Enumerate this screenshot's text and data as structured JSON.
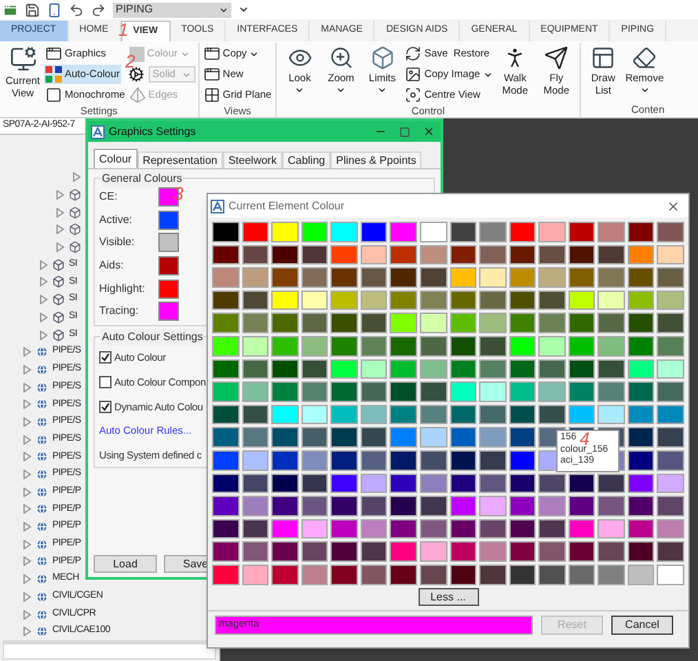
{
  "quick_access": {
    "workspace": "PIPING"
  },
  "ribbon_tabs": [
    {
      "label": "PROJECT",
      "kind": "application",
      "selected": false
    },
    {
      "label": "HOME",
      "kind": "tab",
      "selected": false
    },
    {
      "label": "VIEW",
      "kind": "tab",
      "selected": true
    },
    {
      "label": "TOOLS",
      "kind": "tab",
      "selected": false
    },
    {
      "label": "INTERFACES",
      "kind": "tab",
      "selected": false
    },
    {
      "label": "MANAGE",
      "kind": "tab",
      "selected": false
    },
    {
      "label": "DESIGN AIDS",
      "kind": "tab",
      "selected": false
    },
    {
      "label": "GENERAL",
      "kind": "tab",
      "selected": false
    },
    {
      "label": "EQUIPMENT",
      "kind": "tab",
      "selected": false
    },
    {
      "label": "PIPING",
      "kind": "tab",
      "selected": false
    }
  ],
  "ribbon_groups": [
    {
      "label": "Settings",
      "items": [
        {
          "kind": "large",
          "label": "Current View",
          "disabled": false,
          "highlighted": false,
          "dropdown": false
        },
        {
          "kind": "small",
          "label": "Graphics",
          "disabled": false,
          "highlighted": false,
          "dropdown": false
        },
        {
          "kind": "small",
          "label": "Auto-Colour",
          "disabled": false,
          "highlighted": true,
          "dropdown": false
        },
        {
          "kind": "small",
          "label": "Monochrome",
          "disabled": false,
          "highlighted": false,
          "dropdown": false
        },
        {
          "kind": "small",
          "label": "Colour",
          "disabled": true,
          "highlighted": false,
          "dropdown": true
        },
        {
          "kind": "combo",
          "label": "Solid",
          "disabled": true,
          "highlighted": false,
          "dropdown": true
        },
        {
          "kind": "small",
          "label": "Edges",
          "disabled": true,
          "highlighted": false,
          "dropdown": false
        }
      ]
    },
    {
      "label": "Views",
      "items": [
        {
          "kind": "small",
          "label": "Copy",
          "disabled": false,
          "highlighted": false,
          "dropdown": true
        },
        {
          "kind": "small",
          "label": "New",
          "disabled": false,
          "highlighted": false,
          "dropdown": false
        },
        {
          "kind": "small",
          "label": "Grid Plane",
          "disabled": false,
          "highlighted": false,
          "dropdown": false
        }
      ]
    },
    {
      "label": "Control",
      "items": [
        {
          "kind": "large",
          "label": "Look",
          "disabled": false,
          "highlighted": false,
          "dropdown": true
        },
        {
          "kind": "large",
          "label": "Zoom",
          "disabled": false,
          "highlighted": false,
          "dropdown": true
        },
        {
          "kind": "large",
          "label": "Limits",
          "disabled": false,
          "highlighted": false,
          "dropdown": true
        },
        {
          "kind": "small",
          "label": "Save",
          "label2": "Restore",
          "disabled": false,
          "highlighted": false,
          "dropdown": false
        },
        {
          "kind": "small",
          "label": "Copy Image",
          "disabled": false,
          "highlighted": false,
          "dropdown": true
        },
        {
          "kind": "small",
          "label": "Centre View",
          "disabled": false,
          "highlighted": false,
          "dropdown": false
        },
        {
          "kind": "large",
          "label": "Walk Mode",
          "disabled": false,
          "highlighted": false,
          "dropdown": false
        },
        {
          "kind": "large",
          "label": "Fly Mode",
          "disabled": false,
          "highlighted": false,
          "dropdown": false
        }
      ]
    },
    {
      "label": "Conten",
      "items": [
        {
          "kind": "large",
          "label": "Draw List",
          "disabled": false,
          "highlighted": false,
          "dropdown": false
        },
        {
          "kind": "large",
          "label": "Remove",
          "disabled": false,
          "highlighted": false,
          "dropdown": true
        }
      ]
    }
  ],
  "model_explorer": {
    "header": "SP07A-2-AI-952-7",
    "tree": [
      {
        "children": [
          {
            "children": [
              {
                "children": [
                  {
                    "expanded": false
                  }
                ]
              },
              {
                "kind": "cube",
                "expanded": false
              },
              {
                "kind": "cube",
                "expanded": false
              },
              {
                "kind": "cube",
                "expanded": false
              },
              {
                "kind": "cube",
                "expanded": false
              }
            ]
          },
          {
            "kind": "site",
            "label": "SI",
            "expanded": false
          },
          {
            "kind": "site",
            "label": "SI",
            "expanded": false
          },
          {
            "kind": "site",
            "label": "SI",
            "expanded": false
          },
          {
            "kind": "site",
            "label": "SI",
            "expanded": false
          },
          {
            "kind": "site",
            "label": "SI",
            "expanded": false
          }
        ]
      },
      {
        "kind": "zone",
        "label": "PIPE/S",
        "expanded": false
      },
      {
        "kind": "zone",
        "label": "PIPE/S",
        "expanded": false
      },
      {
        "kind": "zone",
        "label": "PIPE/S",
        "expanded": false
      },
      {
        "kind": "zone",
        "label": "PIPE/S",
        "expanded": false
      },
      {
        "kind": "zone",
        "label": "PIPE/S",
        "expanded": false
      },
      {
        "kind": "zone",
        "label": "PIPE/S",
        "expanded": false
      },
      {
        "kind": "zone",
        "label": "PIPE/S",
        "expanded": false
      },
      {
        "kind": "zone",
        "label": "PIPE/S",
        "expanded": false
      },
      {
        "kind": "zone",
        "label": "PIPE/P",
        "expanded": false
      },
      {
        "kind": "zone",
        "label": "PIPE/P",
        "expanded": false
      },
      {
        "kind": "zone",
        "label": "PIPE/P",
        "expanded": false
      },
      {
        "kind": "zone",
        "label": "PIPE/P",
        "expanded": false
      },
      {
        "kind": "zone",
        "label": "PIPE/P",
        "expanded": false
      },
      {
        "kind": "zone",
        "label": "MECH",
        "expanded": false
      },
      {
        "kind": "zone",
        "label": "CIVIL/CGEN",
        "expanded": false
      },
      {
        "kind": "zone",
        "label": "CIVIL/CPR",
        "expanded": false
      },
      {
        "kind": "zone",
        "label": "CIVIL/CAE100",
        "expanded": false
      }
    ]
  },
  "graphics_settings": {
    "title": "Graphics Settings",
    "tabs": [
      {
        "label": "Colour",
        "selected": true
      },
      {
        "label": "Representation",
        "selected": false
      },
      {
        "label": "Steelwork",
        "selected": false
      },
      {
        "label": "Cabling",
        "selected": false
      },
      {
        "label": "Plines & Ppoints",
        "selected": false
      }
    ],
    "general_colours": {
      "title": "General Colours",
      "items": [
        {
          "label": "CE:",
          "color": "#ff00ff"
        },
        {
          "label": "Active:",
          "color": "#0040ff"
        },
        {
          "label": "Visible:",
          "color": "#c0c0c0"
        },
        {
          "label": "Aids:",
          "color": "#b40000"
        },
        {
          "label": "Highlight:",
          "color": "#ff0000"
        },
        {
          "label": "Tracing:",
          "color": "#ff00ff"
        }
      ]
    },
    "auto_colour_settings": {
      "title": "Auto Colour Settings",
      "options": [
        {
          "label": "Auto Colour",
          "checked": true
        },
        {
          "label": "Auto Colour Compon",
          "checked": false
        },
        {
          "label": "Dynamic Auto Colou",
          "checked": true
        }
      ],
      "link": "Auto Colour Rules...",
      "note": "Using System defined c"
    },
    "buttons": [
      "Load",
      "Save"
    ]
  },
  "colour_dialog": {
    "title": "Current Element Colour",
    "swatch_rows": [
      {
        "swatches": [
          {
            "color": "#000000"
          },
          {
            "color": "#ff0000"
          },
          {
            "color": "#ffff00"
          },
          {
            "color": "#00ff00"
          },
          {
            "color": "#00ffff"
          },
          {
            "color": "#0000ff"
          },
          {
            "color": "#ff00ff"
          },
          {
            "color": "#ffffff"
          },
          {
            "color": "#414141"
          },
          {
            "color": "#808080"
          },
          {
            "color": "#ff0000"
          },
          {
            "color": "#ffaaaa"
          },
          {
            "color": "#bd0000"
          },
          {
            "color": "#bd7e7e"
          },
          {
            "color": "#810000"
          },
          {
            "color": "#815656"
          }
        ]
      },
      {
        "swatches": [
          {
            "color": "#680000"
          },
          {
            "color": "#684545"
          },
          {
            "color": "#4f0000"
          },
          {
            "color": "#4f3535"
          },
          {
            "color": "#ff3f00"
          },
          {
            "color": "#ffbfaa"
          },
          {
            "color": "#bd2e00"
          },
          {
            "color": "#bd8d7e"
          },
          {
            "color": "#811f00"
          },
          {
            "color": "#816056"
          },
          {
            "color": "#681900"
          },
          {
            "color": "#684e45"
          },
          {
            "color": "#4f1300"
          },
          {
            "color": "#4f3b35"
          },
          {
            "color": "#ff7f00"
          },
          {
            "color": "#ffd4aa"
          }
        ]
      },
      {
        "swatches": [
          {
            "color": "#bd8878"
          },
          {
            "color": "#bd9d7e"
          },
          {
            "color": "#813f00"
          },
          {
            "color": "#816b56"
          },
          {
            "color": "#683300"
          },
          {
            "color": "#685645"
          },
          {
            "color": "#4f2600"
          },
          {
            "color": "#4f4135"
          },
          {
            "color": "#ffbf00"
          },
          {
            "color": "#ffeaaa"
          },
          {
            "color": "#bd8d00"
          },
          {
            "color": "#bdad7e"
          },
          {
            "color": "#815f00"
          },
          {
            "color": "#817656"
          },
          {
            "color": "#684e00"
          },
          {
            "color": "#685f45"
          }
        ]
      },
      {
        "swatches": [
          {
            "color": "#4f3b00"
          },
          {
            "color": "#4f4835"
          },
          {
            "color": "#ffff00"
          },
          {
            "color": "#ffffaa"
          },
          {
            "color": "#bdbd00"
          },
          {
            "color": "#bdbd7e"
          },
          {
            "color": "#818100"
          },
          {
            "color": "#818156"
          },
          {
            "color": "#686800"
          },
          {
            "color": "#686845"
          },
          {
            "color": "#4f4f00"
          },
          {
            "color": "#4f4f35"
          },
          {
            "color": "#bfff00"
          },
          {
            "color": "#eaffaa"
          },
          {
            "color": "#8dbd00"
          },
          {
            "color": "#adbd7e"
          }
        ]
      },
      {
        "swatches": [
          {
            "color": "#5f8100"
          },
          {
            "color": "#768156"
          },
          {
            "color": "#4e6800"
          },
          {
            "color": "#5f6845"
          },
          {
            "color": "#3b4f00"
          },
          {
            "color": "#484f35"
          },
          {
            "color": "#7fff00"
          },
          {
            "color": "#d4ffaa"
          },
          {
            "color": "#5ebd00"
          },
          {
            "color": "#9dbd7e"
          },
          {
            "color": "#3f8100"
          },
          {
            "color": "#6b8156"
          },
          {
            "color": "#336800"
          },
          {
            "color": "#566845"
          },
          {
            "color": "#264f00"
          },
          {
            "color": "#414f35"
          }
        ]
      },
      {
        "swatches": [
          {
            "color": "#3fff00"
          },
          {
            "color": "#bfffaa"
          },
          {
            "color": "#2ebd00"
          },
          {
            "color": "#8dbd7e"
          },
          {
            "color": "#1f8100"
          },
          {
            "color": "#608156"
          },
          {
            "color": "#196800"
          },
          {
            "color": "#4e6845"
          },
          {
            "color": "#134f00"
          },
          {
            "color": "#3b4f35"
          },
          {
            "color": "#00ff00"
          },
          {
            "color": "#aaffaa"
          },
          {
            "color": "#00bd00"
          },
          {
            "color": "#7ebd7e"
          },
          {
            "color": "#008100"
          },
          {
            "color": "#568156"
          }
        ]
      },
      {
        "swatches": [
          {
            "color": "#006800"
          },
          {
            "color": "#456845"
          },
          {
            "color": "#004f00"
          },
          {
            "color": "#354f35"
          },
          {
            "color": "#00ff3f"
          },
          {
            "color": "#aaffbf"
          },
          {
            "color": "#00bd2e"
          },
          {
            "color": "#7ebd8d"
          },
          {
            "color": "#00811f"
          },
          {
            "color": "#568160"
          },
          {
            "color": "#006819"
          },
          {
            "color": "#45684e"
          },
          {
            "color": "#004f13"
          },
          {
            "color": "#354f3b"
          },
          {
            "color": "#00ff7f"
          },
          {
            "color": "#aaffd4"
          }
        ]
      },
      {
        "swatches": [
          {
            "color": "#00bd5e"
          },
          {
            "color": "#7ebd9d"
          },
          {
            "color": "#00813f"
          },
          {
            "color": "#56816b"
          },
          {
            "color": "#006833"
          },
          {
            "color": "#456856"
          },
          {
            "color": "#004f26"
          },
          {
            "color": "#354f41"
          },
          {
            "color": "#00ffbf"
          },
          {
            "color": "#aaffea"
          },
          {
            "color": "#00bd8d"
          },
          {
            "color": "#7ebdad"
          },
          {
            "color": "#00815f"
          },
          {
            "color": "#568176"
          },
          {
            "color": "#00684e"
          },
          {
            "color": "#45685f"
          }
        ]
      },
      {
        "swatches": [
          {
            "color": "#004f3b"
          },
          {
            "color": "#354f48"
          },
          {
            "color": "#00ffff"
          },
          {
            "color": "#aaffff"
          },
          {
            "color": "#00bdbd"
          },
          {
            "color": "#7ebdbd"
          },
          {
            "color": "#008181"
          },
          {
            "color": "#568181"
          },
          {
            "color": "#006868"
          },
          {
            "color": "#456868"
          },
          {
            "color": "#004f4f"
          },
          {
            "color": "#354f4f"
          },
          {
            "color": "#00bfff"
          },
          {
            "color": "#aaeaff"
          },
          {
            "color": "#008dbd"
          },
          {
            "color": "#0088bb"
          }
        ]
      },
      {
        "swatches": [
          {
            "color": "#005f81"
          },
          {
            "color": "#567681"
          },
          {
            "color": "#004e68"
          },
          {
            "color": "#455f68"
          },
          {
            "color": "#003b4f"
          },
          {
            "color": "#35484f"
          },
          {
            "color": "#007fff"
          },
          {
            "color": "#aad4ff"
          },
          {
            "color": "#005ebd"
          },
          {
            "color": "#7e9dbd"
          },
          {
            "color": "#003f81"
          },
          {
            "color": "#566b81"
          },
          {
            "color": "#003368"
          },
          {
            "color": "#455668"
          },
          {
            "color": "#00264f"
          },
          {
            "color": "#35414f"
          }
        ]
      },
      {
        "swatches": [
          {
            "color": "#003fff"
          },
          {
            "color": "#aabfff"
          },
          {
            "color": "#002ebd"
          },
          {
            "color": "#7e8dbd"
          },
          {
            "color": "#001f81"
          },
          {
            "color": "#566081"
          },
          {
            "color": "#001968"
          },
          {
            "color": "#454e68"
          },
          {
            "color": "#00134f"
          },
          {
            "color": "#353b4f"
          },
          {
            "color": "#0000ff"
          },
          {
            "color": "#aaaaff"
          }
        ],
        "swatches_after_tooltip": [
          {
            "color": "#7e7ebd"
          },
          {
            "color": "#000081"
          },
          {
            "color": "#565681"
          }
        ]
      },
      {
        "swatches": [
          {
            "color": "#000068"
          },
          {
            "color": "#454568"
          },
          {
            "color": "#00004f"
          },
          {
            "color": "#35354f"
          },
          {
            "color": "#3f00ff"
          },
          {
            "color": "#bfaaff"
          },
          {
            "color": "#2e00bd"
          },
          {
            "color": "#8d7ebd"
          },
          {
            "color": "#1f0081"
          },
          {
            "color": "#605681"
          },
          {
            "color": "#190068"
          },
          {
            "color": "#4e4568"
          },
          {
            "color": "#13004f"
          },
          {
            "color": "#3b354f"
          },
          {
            "color": "#7f00ff"
          },
          {
            "color": "#d4aaff"
          }
        ]
      },
      {
        "swatches": [
          {
            "color": "#5e00bd"
          },
          {
            "color": "#9d7ebd"
          },
          {
            "color": "#3f0081"
          },
          {
            "color": "#6b5681"
          },
          {
            "color": "#330068"
          },
          {
            "color": "#564568"
          },
          {
            "color": "#26004f"
          },
          {
            "color": "#41354f"
          },
          {
            "color": "#bf00ff"
          },
          {
            "color": "#eaaaff"
          },
          {
            "color": "#8d00bd"
          },
          {
            "color": "#ad7ebd"
          },
          {
            "color": "#5f0081"
          },
          {
            "color": "#765681"
          },
          {
            "color": "#4e0068"
          },
          {
            "color": "#5f4568"
          }
        ]
      },
      {
        "swatches": [
          {
            "color": "#3b004f"
          },
          {
            "color": "#48354f"
          },
          {
            "color": "#ff00ff"
          },
          {
            "color": "#ffaaff"
          },
          {
            "color": "#bd00bd"
          },
          {
            "color": "#bd7ebd"
          },
          {
            "color": "#810081"
          },
          {
            "color": "#815681"
          },
          {
            "color": "#680068"
          },
          {
            "color": "#684568"
          },
          {
            "color": "#4f004f"
          },
          {
            "color": "#4f354f"
          },
          {
            "color": "#ff00bf"
          },
          {
            "color": "#ffaaea"
          },
          {
            "color": "#bd008d"
          },
          {
            "color": "#bd7ead"
          }
        ]
      },
      {
        "swatches": [
          {
            "color": "#81005f"
          },
          {
            "color": "#815676"
          },
          {
            "color": "#68004e"
          },
          {
            "color": "#68455f"
          },
          {
            "color": "#4f003b"
          },
          {
            "color": "#4f3548"
          },
          {
            "color": "#ff007f"
          },
          {
            "color": "#ffaad4"
          },
          {
            "color": "#bd005e"
          },
          {
            "color": "#bd7e9d"
          },
          {
            "color": "#81003f"
          },
          {
            "color": "#81566b"
          },
          {
            "color": "#680033"
          },
          {
            "color": "#684556"
          },
          {
            "color": "#4f0026"
          },
          {
            "color": "#4f3541"
          }
        ]
      },
      {
        "swatches": [
          {
            "color": "#ff003f"
          },
          {
            "color": "#ffaabf"
          },
          {
            "color": "#bd002e"
          },
          {
            "color": "#bd7e8d"
          },
          {
            "color": "#81001f"
          },
          {
            "color": "#815660"
          },
          {
            "color": "#680019"
          },
          {
            "color": "#68454e"
          },
          {
            "color": "#4f0013"
          },
          {
            "color": "#4f353b"
          },
          {
            "color": "#333333"
          },
          {
            "color": "#505050"
          },
          {
            "color": "#696969"
          },
          {
            "color": "#808080"
          },
          {
            "color": "#bebebe"
          },
          {
            "color": "#ffffff"
          }
        ]
      }
    ],
    "tooltip": [
      "156",
      "colour_156",
      "aci_139"
    ],
    "more_button": "Less ...",
    "colour_name": "magenta",
    "buttons": [
      {
        "label": "Reset",
        "disabled": true
      },
      {
        "label": "Cancel",
        "disabled": false
      }
    ]
  },
  "annotations": [
    "1",
    "2",
    "3",
    "4"
  ]
}
